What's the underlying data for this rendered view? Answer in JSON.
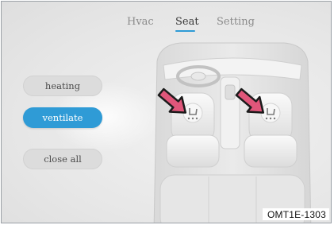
{
  "tabs": [
    {
      "label": "Hvac",
      "active": false
    },
    {
      "label": "Seat",
      "active": true
    },
    {
      "label": "Setting",
      "active": false
    }
  ],
  "modes": {
    "heating": "heating",
    "ventilate": "ventilate",
    "close_all": "close all"
  },
  "active_mode": "ventilate",
  "caption": "OMT1E-1303",
  "colors": {
    "accent": "#2f9bd6",
    "arrow_fill": "#e0567a"
  },
  "icons": [
    "seat-ventilation-icon",
    "seat-ventilation-icon",
    "pointer-arrow-icon",
    "pointer-arrow-icon"
  ]
}
